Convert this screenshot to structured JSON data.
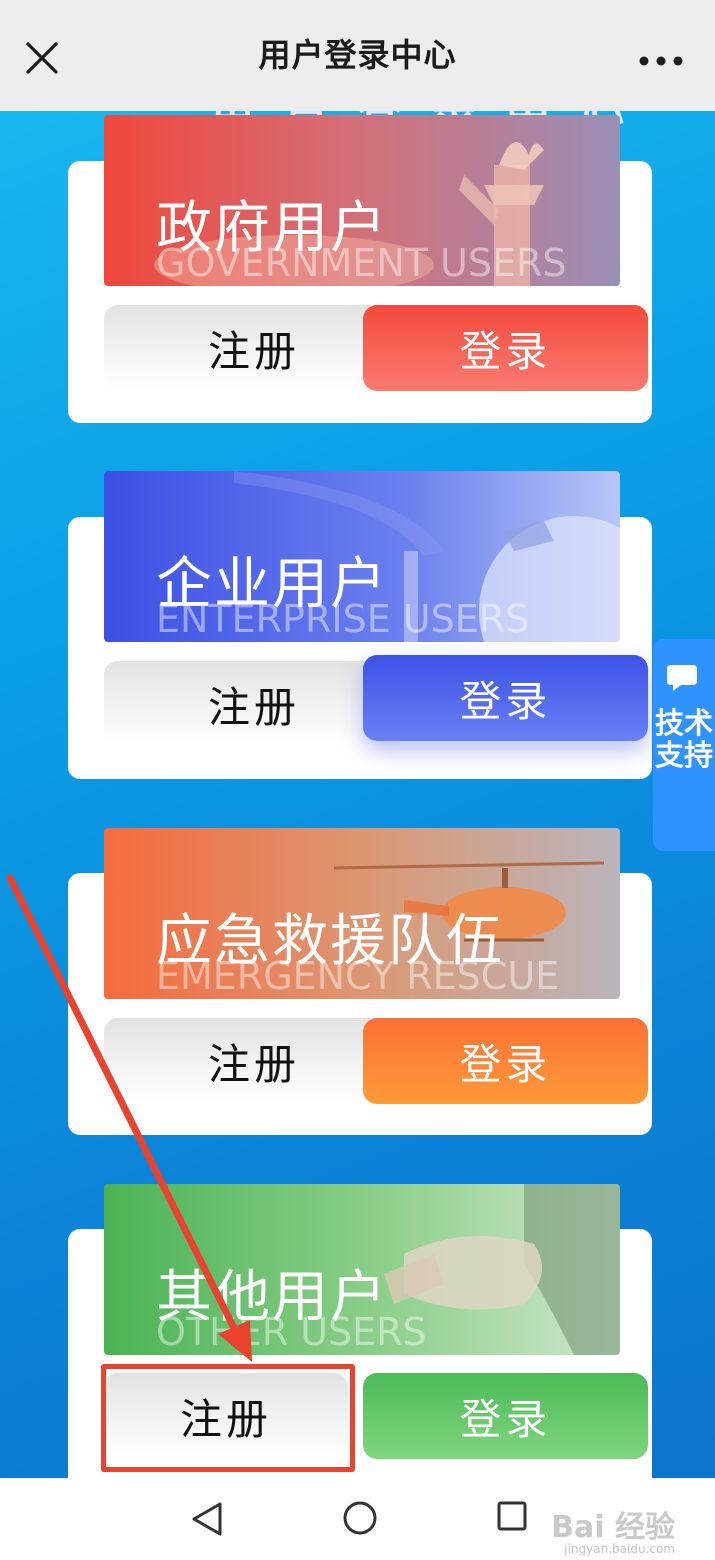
{
  "header": {
    "title": "用户登录中心"
  },
  "background_title": "用户登录中心",
  "cards": [
    {
      "title_cn": "政府用户",
      "title_en": "GOVERNMENT USERS",
      "register_label": "注册",
      "login_label": "登录",
      "color": "#f34a3c"
    },
    {
      "title_cn": "企业用户",
      "title_en": "ENTERPRISE USERS",
      "register_label": "注册",
      "login_label": "登录",
      "color": "#3d52e6"
    },
    {
      "title_cn": "应急救援队伍",
      "title_en": "EMERGENCY RESCUE",
      "register_label": "注册",
      "login_label": "登录",
      "color": "#fb7136"
    },
    {
      "title_cn": "其他用户",
      "title_en": "OTHER USERS",
      "register_label": "注册",
      "login_label": "登录",
      "color": "#4cba58"
    }
  ],
  "support": {
    "label": "技术支持"
  },
  "watermark": {
    "text": "Bai 经验",
    "sub": "jingyan.baidu.com"
  },
  "colors": {
    "topbar": "#ededed",
    "annotation": "#e8432f",
    "support": "#2f93ff"
  }
}
